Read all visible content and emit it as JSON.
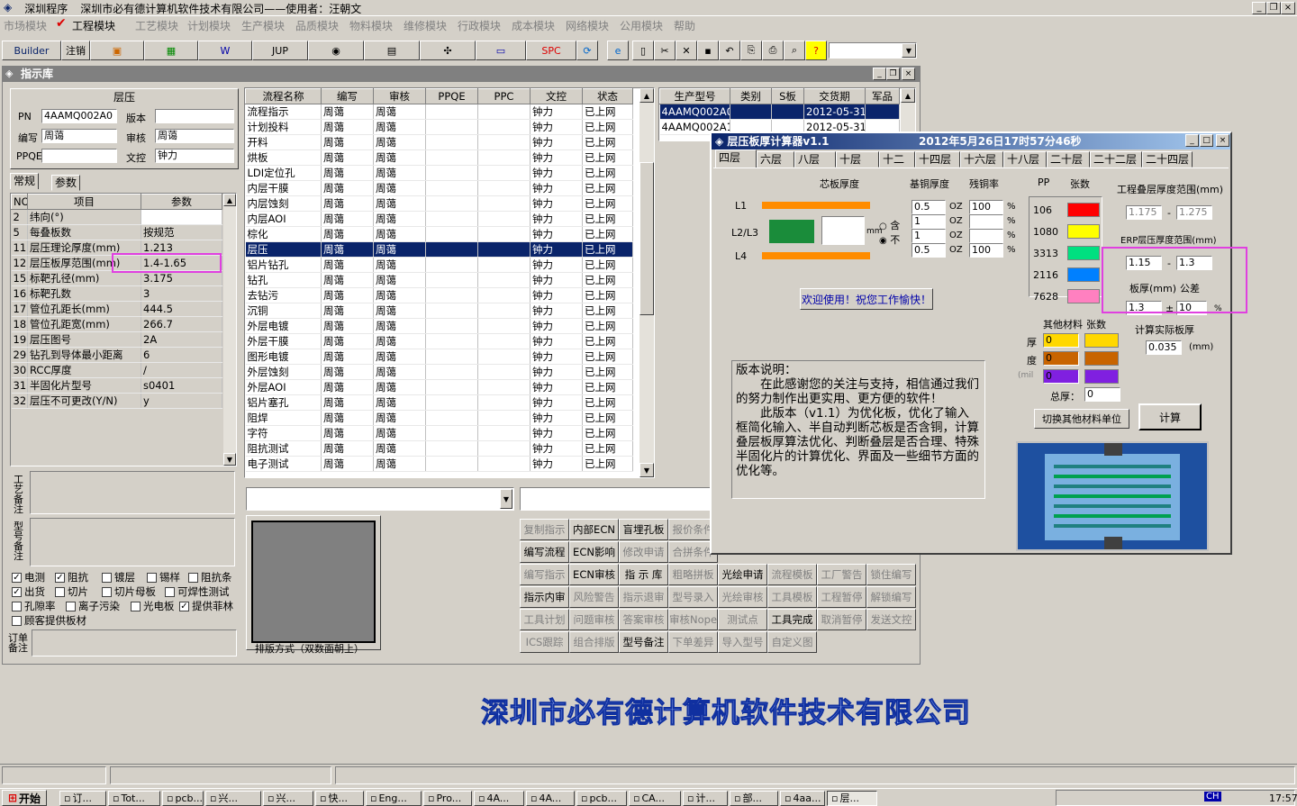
{
  "window": {
    "app": "深圳程序",
    "title": "深圳市必有德计算机软件技术有限公司——使用者：汪朝文",
    "controls": [
      "_",
      "❐",
      "×"
    ]
  },
  "menu": [
    "市场模块",
    "工程模块",
    "工艺模块",
    "计划模块",
    "生产模块",
    "品质模块",
    "物料模块",
    "维修模块",
    "行政模块",
    "成本模块",
    "网络模块",
    "公用模块",
    "帮助"
  ],
  "toolbar": {
    "builder": "Builder",
    "logout": "注销",
    "jup": "JUP",
    "spc": "SPC"
  },
  "inner": {
    "title": "指示库"
  },
  "left": {
    "section": "层压",
    "fields": {
      "pn_label": "PN",
      "pn": "4AAMQ002A0",
      "ver_label": "版本",
      "ver": "",
      "author_label": "编写",
      "author": "周蔼",
      "review_label": "审核",
      "review": "周蔼",
      "ppqe_label": "PPQE",
      "ppqe": "",
      "doc_label": "文控",
      "doc": "钟力"
    },
    "tabs": [
      "常规",
      "参数"
    ],
    "param_headers": [
      "NO",
      "项目",
      "参数"
    ],
    "params": [
      [
        "2",
        "纬向(°)",
        ""
      ],
      [
        "5",
        "每叠板数",
        "按规范"
      ],
      [
        "11",
        "层压理论厚度(mm)",
        "1.213"
      ],
      [
        "12",
        "层压板厚范围(mm)",
        "1.4-1.65"
      ],
      [
        "15",
        "标靶孔径(mm)",
        "3.175"
      ],
      [
        "16",
        "标靶孔数",
        "3"
      ],
      [
        "17",
        "管位孔距长(mm)",
        "444.5"
      ],
      [
        "18",
        "管位孔距宽(mm)",
        "266.7"
      ],
      [
        "19",
        "层压图号",
        "2A"
      ],
      [
        "29",
        "钻孔到导体最小距离",
        "6"
      ],
      [
        "30",
        "RCC厚度",
        "/"
      ],
      [
        "31",
        "半固化片型号",
        "s0401"
      ],
      [
        "32",
        "层压不可更改(Y/N)",
        "y"
      ]
    ],
    "notes": [
      "工艺备注",
      "型号备注",
      "订单备注"
    ],
    "checks": [
      [
        "电测",
        true
      ],
      [
        "阻抗",
        true
      ],
      [
        "镀层",
        false
      ],
      [
        "锡样",
        false
      ],
      [
        "阻抗条",
        false
      ],
      [
        "出货",
        true
      ],
      [
        "切片",
        false
      ],
      [
        "切片母板",
        false
      ],
      [
        "可焊性测试",
        false
      ],
      [
        "孔隙率",
        false
      ],
      [
        "离子污染",
        false
      ],
      [
        "光电板",
        false
      ],
      [
        "提供菲林",
        true
      ],
      [
        "顾客提供板材",
        false
      ]
    ]
  },
  "process": {
    "headers": [
      "流程名称",
      "编写",
      "审核",
      "PPQE",
      "PPC",
      "文控",
      "状态"
    ],
    "rows": [
      [
        "流程指示",
        "周蔼",
        "周蔼",
        "",
        "",
        "钟力",
        "已上网"
      ],
      [
        "计划投料",
        "周蔼",
        "周蔼",
        "",
        "",
        "钟力",
        "已上网"
      ],
      [
        "开料",
        "周蔼",
        "周蔼",
        "",
        "",
        "钟力",
        "已上网"
      ],
      [
        "烘板",
        "周蔼",
        "周蔼",
        "",
        "",
        "钟力",
        "已上网"
      ],
      [
        "LDI定位孔",
        "周蔼",
        "周蔼",
        "",
        "",
        "钟力",
        "已上网"
      ],
      [
        "内层干膜",
        "周蔼",
        "周蔼",
        "",
        "",
        "钟力",
        "已上网"
      ],
      [
        "内层蚀刻",
        "周蔼",
        "周蔼",
        "",
        "",
        "钟力",
        "已上网"
      ],
      [
        "内层AOI",
        "周蔼",
        "周蔼",
        "",
        "",
        "钟力",
        "已上网"
      ],
      [
        "棕化",
        "周蔼",
        "周蔼",
        "",
        "",
        "钟力",
        "已上网"
      ],
      [
        "层压",
        "周蔼",
        "周蔼",
        "",
        "",
        "钟力",
        "已上网"
      ],
      [
        "铝片钻孔",
        "周蔼",
        "周蔼",
        "",
        "",
        "钟力",
        "已上网"
      ],
      [
        "钻孔",
        "周蔼",
        "周蔼",
        "",
        "",
        "钟力",
        "已上网"
      ],
      [
        "去钻污",
        "周蔼",
        "周蔼",
        "",
        "",
        "钟力",
        "已上网"
      ],
      [
        "沉铜",
        "周蔼",
        "周蔼",
        "",
        "",
        "钟力",
        "已上网"
      ],
      [
        "外层电镀",
        "周蔼",
        "周蔼",
        "",
        "",
        "钟力",
        "已上网"
      ],
      [
        "外层干膜",
        "周蔼",
        "周蔼",
        "",
        "",
        "钟力",
        "已上网"
      ],
      [
        "图形电镀",
        "周蔼",
        "周蔼",
        "",
        "",
        "钟力",
        "已上网"
      ],
      [
        "外层蚀刻",
        "周蔼",
        "周蔼",
        "",
        "",
        "钟力",
        "已上网"
      ],
      [
        "外层AOI",
        "周蔼",
        "周蔼",
        "",
        "",
        "钟力",
        "已上网"
      ],
      [
        "铝片塞孔",
        "周蔼",
        "周蔼",
        "",
        "",
        "钟力",
        "已上网"
      ],
      [
        "阻焊",
        "周蔼",
        "周蔼",
        "",
        "",
        "钟力",
        "已上网"
      ],
      [
        "字符",
        "周蔼",
        "周蔼",
        "",
        "",
        "钟力",
        "已上网"
      ],
      [
        "阻抗测试",
        "周蔼",
        "周蔼",
        "",
        "",
        "钟力",
        "已上网"
      ],
      [
        "电子测试",
        "周蔼",
        "周蔼",
        "",
        "",
        "钟力",
        "已上网"
      ]
    ],
    "selected": 9
  },
  "orders": {
    "headers": [
      "生产型号",
      "类别",
      "S板",
      "交货期",
      "军品"
    ],
    "rows": [
      [
        "4AAMQ002A0",
        "",
        "",
        "2012-05-31",
        ""
      ],
      [
        "4AAMQ002A1",
        "",
        "",
        "2012-05-31",
        ""
      ]
    ]
  },
  "layout_caption": "排版方式（双数面朝上）",
  "action_buttons": [
    [
      "复制指示",
      "内部ECN",
      "盲埋孔板",
      "报价条件",
      "",
      "",
      "",
      ""
    ],
    [
      "编写流程",
      "ECN影响",
      "修改申请",
      "合拼条件",
      "",
      "",
      "",
      ""
    ],
    [
      "编写指示",
      "ECN审核",
      "指 示 库",
      "粗略拼板",
      "光绘申请",
      "流程模板",
      "工厂警告",
      "锁住编写"
    ],
    [
      "指示内审",
      "风险警告",
      "指示退审",
      "型号录入",
      "光绘审核",
      "工具模板",
      "工程暂停",
      "解锁编写"
    ],
    [
      "工具计划",
      "问题审核",
      "答案审核",
      "审核Nope",
      "测试点",
      "工具完成",
      "取消暂停",
      "发送文控"
    ],
    [
      "ICS跟踪",
      "组合排版",
      "型号备注",
      "下单差异",
      "导入型号",
      "自定义图",
      "",
      ""
    ]
  ],
  "action_enabled": [
    "内部ECN",
    "盲埋孔板",
    "编写流程",
    "ECN影响",
    "ECN审核",
    "指 示 库",
    "光绘申请",
    "指示内审",
    "工具完成",
    "型号备注"
  ],
  "calc": {
    "title": "层压板厚计算器v1.1",
    "datetime": "2012年5月26日17时57分46秒",
    "tabs": [
      "四层",
      "六层",
      "八层",
      "十层",
      "十二",
      "十四层",
      "十六层",
      "十八层",
      "二十层",
      "二十二层",
      "二十四层"
    ],
    "col_labels": {
      "core": "芯板厚度",
      "base_cu": "基铜厚度",
      "residual": "残铜率",
      "pp": "PP",
      "count": "张数"
    },
    "layers": [
      "L1",
      "L2/L3",
      "L4"
    ],
    "mm": "mm",
    "contain": "含",
    "not": "不",
    "cu_values": [
      "0.5",
      "1",
      "1",
      "0.5"
    ],
    "oz": "OZ",
    "residual_values": [
      "100",
      "",
      "",
      "100"
    ],
    "pct": "%",
    "pp_types": [
      "106",
      "1080",
      "3313",
      "2116",
      "7628"
    ],
    "pp_colors": [
      "#ff0000",
      "#ffff00",
      "#00e080",
      "#0080ff",
      "#ff80c0"
    ],
    "welcome": "欢迎使用！祝您工作愉快！",
    "range_title": "工程叠层厚度范围(mm)",
    "range_min": "1.175",
    "range_max": "1.275",
    "erp_title": "ERP层压厚度范围(mm)",
    "erp_min": "1.15",
    "erp_max": "1.3",
    "thickness_label": "板厚(mm)",
    "tolerance_label": "公差",
    "thickness": "1.3",
    "pm": "±",
    "tolerance": "10",
    "pct2": "%",
    "actual_label": "计算实际板厚",
    "actual": "0.035",
    "actual_unit": "(mm)",
    "other_label": "其他材料",
    "other_count_label": "张数",
    "thick_chars": [
      "厚",
      "度"
    ],
    "mil": "(mil",
    "other_values": [
      "0",
      "0",
      "0"
    ],
    "total_label": "总厚：",
    "total": "0",
    "switch_btn": "切换其他材料单位",
    "calc_btn": "计算",
    "notes": "版本说明：\n　　在此感谢您的关注与支持，相信通过我们的努力制作出更实用、更方便的软件！\n　　此版本（v1.1）为优化板，优化了输入框简化输入、半自动判断芯板是否含铜，计算叠层板厚算法优化、判断叠层是否合理、特殊半固化片的计算优化、界面及一些细节方面的优化等。"
  },
  "company": "深圳市必有德计算机软件技术有限公司",
  "taskbar": {
    "start": "开始",
    "tasks": [
      "订...",
      "Tot...",
      "pcb...",
      "兴...",
      "兴...",
      "快...",
      "Eng...",
      "Pro...",
      "4A...",
      "4A...",
      "pcb...",
      "CA...",
      "计...",
      "部...",
      "4aa...",
      "层..."
    ],
    "tray_lang": "CH",
    "clock": "17:57"
  }
}
